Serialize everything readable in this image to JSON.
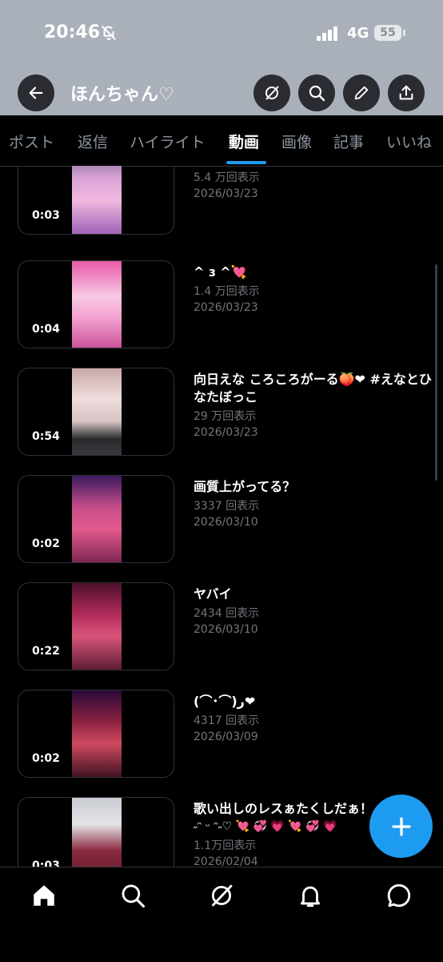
{
  "status_bar": {
    "time": "20:46",
    "network": "4G",
    "battery": "55"
  },
  "header": {
    "title": "ほんちゃん♡"
  },
  "tabs": [
    {
      "label": "ポスト"
    },
    {
      "label": "返信"
    },
    {
      "label": "ハイライト"
    },
    {
      "label": "動画"
    },
    {
      "label": "画像"
    },
    {
      "label": "記事"
    },
    {
      "label": "いいね"
    }
  ],
  "active_tab": "動画",
  "videos": [
    {
      "duration": "0:03",
      "title": "",
      "views": "5.4 万回表示",
      "date": "2026/03/23"
    },
    {
      "duration": "0:04",
      "title": "^ ɜ ^💘",
      "views": "1.4 万回表示",
      "date": "2026/03/23"
    },
    {
      "duration": "0:54",
      "title": "向日えな ころころがーる🍑❤ #えなとひなたぼっこ",
      "views": "29 万回表示",
      "date": "2026/03/23"
    },
    {
      "duration": "0:02",
      "title": "画質上がってる？",
      "views": "3337 回表示",
      "date": "2026/03/10"
    },
    {
      "duration": "0:22",
      "title": "ヤバイ",
      "views": "2434 回表示",
      "date": "2026/03/10"
    },
    {
      "duration": "0:02",
      "title": "(⌒･⌒)ر❤",
      "views": "4317 回表示",
      "date": "2026/03/09"
    },
    {
      "duration": "0:03",
      "title": "歌い出しのレスぁたくしだぁ！",
      "title2": "˶ᵔ ᵕ ᵔ˶♡ 💘 💞 💗 💘 💞 💗",
      "views": "1.1万回表示",
      "date": "2026/02/04"
    }
  ],
  "bottom_nav": [
    {
      "icon": "home-icon"
    },
    {
      "icon": "search-icon"
    },
    {
      "icon": "grok-icon"
    },
    {
      "icon": "bell-icon"
    },
    {
      "icon": "messages-icon"
    }
  ],
  "colors": {
    "accent": "#1d9bf0",
    "background": "#000000",
    "header": "#aab0b9",
    "muted": "#71767b"
  }
}
